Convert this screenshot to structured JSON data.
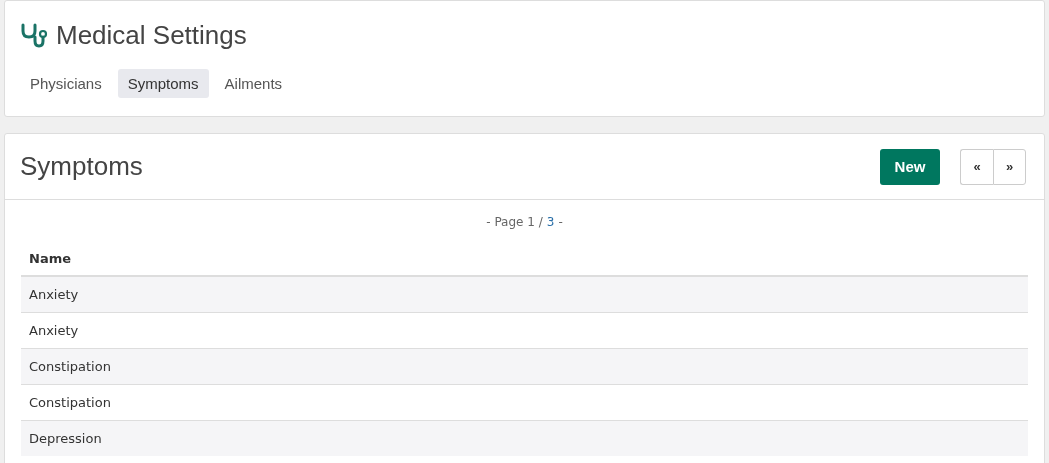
{
  "header": {
    "title": "Medical Settings"
  },
  "tabs": [
    {
      "label": "Physicians",
      "selected": false
    },
    {
      "label": "Symptoms",
      "selected": true
    },
    {
      "label": "Ailments",
      "selected": false
    }
  ],
  "panel": {
    "title": "Symptoms",
    "new_button": "New",
    "prev_button": "«",
    "next_button": "»"
  },
  "pagination": {
    "prefix": "- Page 1 /",
    "link": "3",
    "suffix": "-"
  },
  "table": {
    "columns": [
      "Name"
    ],
    "rows": [
      [
        "Anxiety"
      ],
      [
        "Anxiety"
      ],
      [
        "Constipation"
      ],
      [
        "Constipation"
      ],
      [
        "Depression"
      ]
    ]
  }
}
